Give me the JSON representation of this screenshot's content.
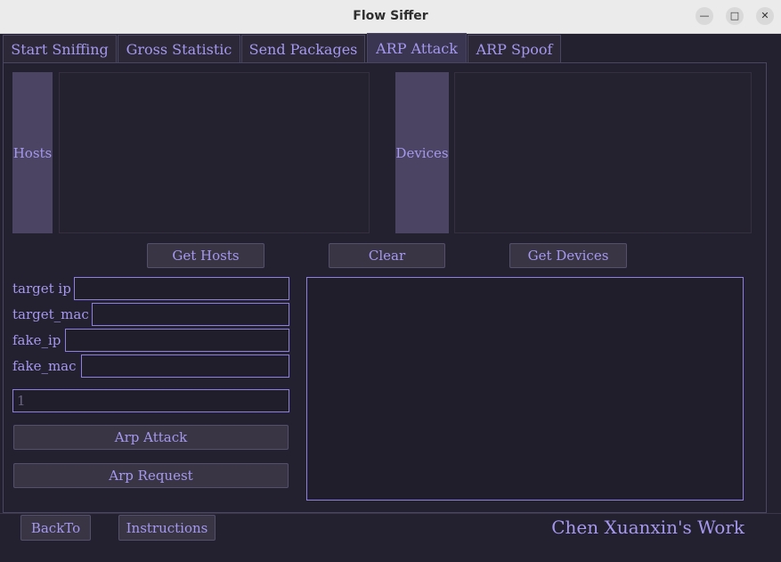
{
  "window": {
    "title": "Flow Siffer",
    "minimize_icon": "minimize-icon",
    "maximize_icon": "maximize-icon",
    "close_icon": "close-icon"
  },
  "tabs": [
    {
      "label": "Start Sniffing"
    },
    {
      "label": "Gross Statistic"
    },
    {
      "label": "Send Packages"
    },
    {
      "label": "ARP Attack",
      "active": true
    },
    {
      "label": "ARP Spoof"
    }
  ],
  "panels": {
    "hosts_label": "Hosts",
    "devices_label": "Devices"
  },
  "buttons": {
    "get_hosts": "Get Hosts",
    "clear": "Clear",
    "get_devices": "Get Devices",
    "arp_attack": "Arp Attack",
    "arp_request": "Arp Request",
    "back_to": "BackTo",
    "instructions": "Instructions"
  },
  "form": {
    "target_ip_label": "target ip",
    "target_mac_label": "target_mac",
    "fake_ip_label": "fake_ip",
    "fake_mac_label": "fake_mac",
    "target_ip_value": "",
    "target_mac_value": "",
    "fake_ip_value": "",
    "fake_mac_value": "",
    "count_value": "1"
  },
  "footer": {
    "credit": "Chen Xuanxin's Work"
  },
  "colors": {
    "accent": "#a598ee",
    "background": "#23202f",
    "panel_label_bg": "#4b4462"
  }
}
